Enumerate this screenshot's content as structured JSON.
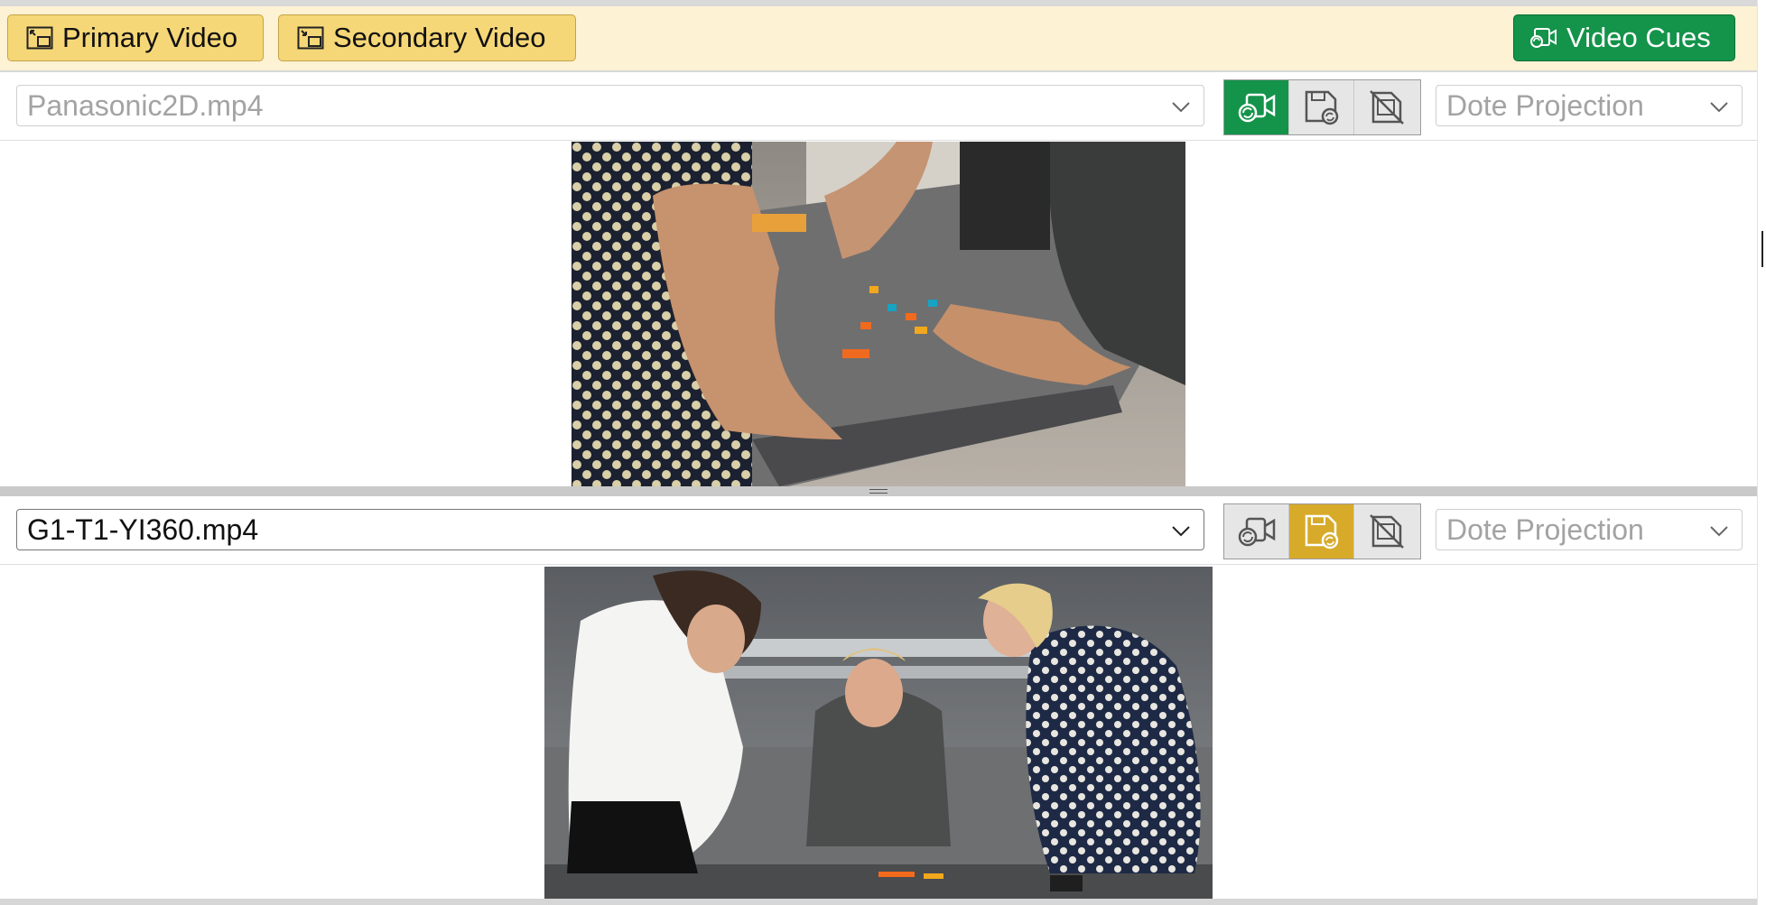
{
  "toolbar": {
    "primary_label": "Primary Video",
    "secondary_label": "Secondary Video",
    "cues_label": "Video Cues"
  },
  "primary": {
    "file": "Panasonic2D.mp4",
    "projection": "Dote Projection",
    "active_mode": "video-sync"
  },
  "secondary": {
    "file": "G1-T1-YI360.mp4",
    "projection": "Dote Projection",
    "active_mode": "save-sync"
  },
  "colors": {
    "toolbar_bg": "#fdf2d3",
    "yellow_button": "#f6d777",
    "green_accent": "#14934a",
    "yellow_accent": "#d7aa2a"
  }
}
